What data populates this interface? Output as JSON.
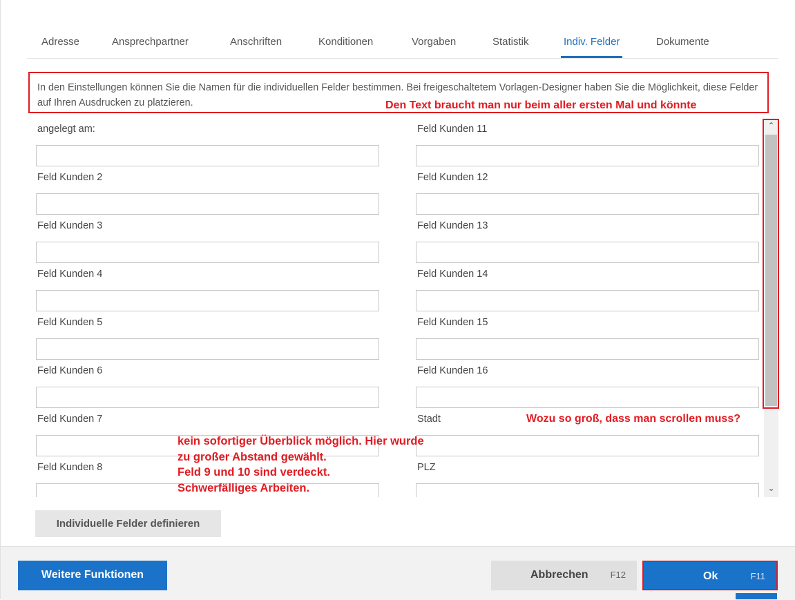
{
  "tabs": [
    "Adresse",
    "Ansprechpartner",
    "Anschriften",
    "Konditionen",
    "Vorgaben",
    "Statistik",
    "Indiv. Felder",
    "Dokumente"
  ],
  "active_tab": "Indiv. Felder",
  "info_text": "In den Einstellungen können Sie die Namen für die individuellen Felder bestimmen. Bei freigeschaltetem Vorlagen-Designer haben Sie die Möglichkeit, diese Felder auf Ihren Ausdrucken zu platzieren.",
  "annotations": {
    "info": "Den Text braucht man nur beim aller ersten Mal  und könnte",
    "scroll": "Wozu so groß, dass man scrollen muss?",
    "layout": [
      "kein sofortiger Überblick möglich. Hier wurde",
      "zu großer Abstand gewählt.",
      "Feld 9 und 10 sind verdeckt.",
      "Schwerfälliges Arbeiten."
    ]
  },
  "fields_left": [
    "angelegt am:",
    "Feld Kunden 2",
    "Feld Kunden 3",
    "Feld Kunden 4",
    "Feld Kunden 5",
    "Feld Kunden 6",
    "Feld Kunden 7",
    "Feld Kunden 8"
  ],
  "fields_right": [
    "Feld Kunden 11",
    "Feld Kunden 12",
    "Feld Kunden 13",
    "Feld Kunden 14",
    "Feld Kunden 15",
    "Feld Kunden 16",
    "Stadt",
    "PLZ"
  ],
  "buttons": {
    "define": "Individuelle Felder definieren",
    "more": "Weitere Funktionen",
    "cancel": "Abbrechen",
    "cancel_key": "F12",
    "ok": "Ok",
    "ok_key": "F11"
  },
  "colors": {
    "accent": "#1a73c9",
    "annotation": "#e11b22"
  }
}
